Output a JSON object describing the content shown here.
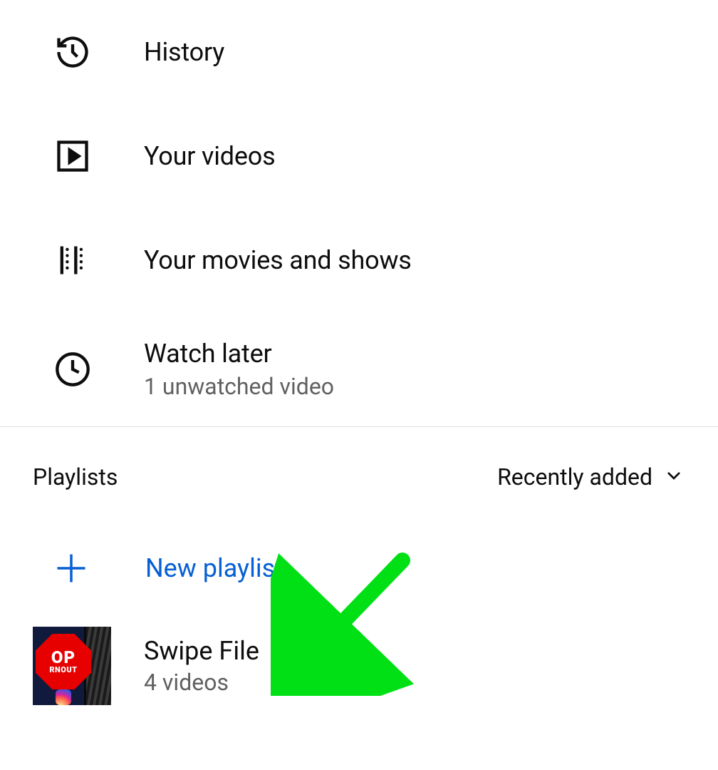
{
  "library": {
    "items": [
      {
        "label": "History",
        "icon": "history"
      },
      {
        "label": "Your videos",
        "icon": "play-square"
      },
      {
        "label": "Your movies and shows",
        "icon": "film"
      },
      {
        "label": "Watch later",
        "icon": "clock",
        "sub": "1 unwatched video"
      }
    ]
  },
  "playlists": {
    "header": "Playlists",
    "sort_label": "Recently added",
    "new_label": "New playlist",
    "items": [
      {
        "title": "Swipe File",
        "count": "4 videos",
        "thumb": {
          "text1": "OP",
          "text2": "RNOUT"
        }
      }
    ]
  },
  "colors": {
    "accent": "#065fd4",
    "annotation_arrow": "#00e015"
  }
}
